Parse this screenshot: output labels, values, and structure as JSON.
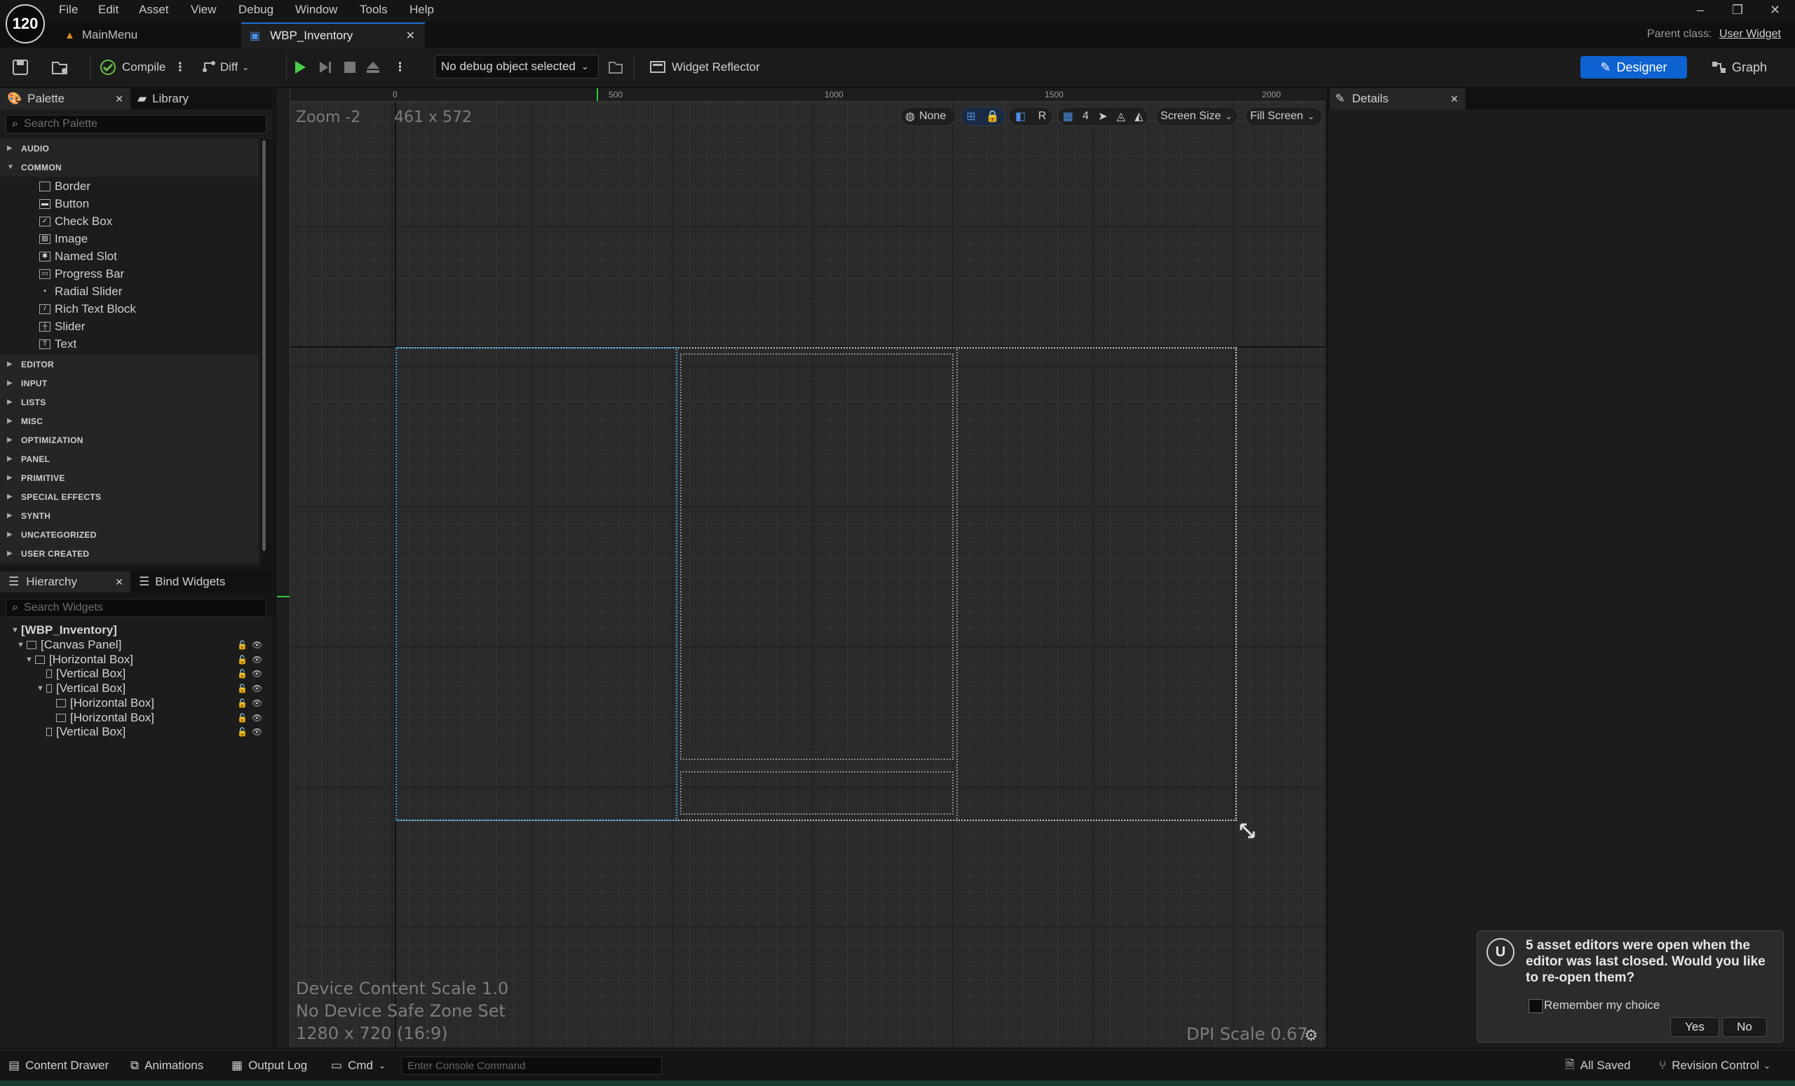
{
  "app": {
    "logo_text": "120"
  },
  "menu": [
    "File",
    "Edit",
    "Asset",
    "View",
    "Debug",
    "Window",
    "Tools",
    "Help"
  ],
  "window_controls": {
    "minimize": "–",
    "restore": "❐",
    "close": "✕"
  },
  "tabs": [
    {
      "label": "MainMenu",
      "active": false
    },
    {
      "label": "WBP_Inventory",
      "active": true
    }
  ],
  "parent_class": {
    "label": "Parent class:",
    "value": "User Widget"
  },
  "toolbar": {
    "compile_label": "Compile",
    "diff_label": "Diff",
    "debug_select": "No debug object selected",
    "widget_reflector": "Widget Reflector",
    "designer_label": "Designer",
    "graph_label": "Graph"
  },
  "palette": {
    "tab_label": "Palette",
    "library_label": "Library",
    "search_placeholder": "Search Palette",
    "categories_top": [
      "AUDIO",
      "COMMON"
    ],
    "common_items": [
      {
        "label": "Border",
        "icon": "border-icon"
      },
      {
        "label": "Button",
        "icon": "button-icon"
      },
      {
        "label": "Check Box",
        "icon": "checkbox-icon"
      },
      {
        "label": "Image",
        "icon": "image-icon"
      },
      {
        "label": "Named Slot",
        "icon": "named-slot-icon"
      },
      {
        "label": "Progress Bar",
        "icon": "progress-bar-icon"
      },
      {
        "label": "Radial Slider",
        "icon": "radial-slider-icon"
      },
      {
        "label": "Rich Text Block",
        "icon": "rich-text-icon"
      },
      {
        "label": "Slider",
        "icon": "slider-icon"
      },
      {
        "label": "Text",
        "icon": "text-icon"
      }
    ],
    "categories_bottom": [
      "EDITOR",
      "INPUT",
      "LISTS",
      "MISC",
      "OPTIMIZATION",
      "PANEL",
      "PRIMITIVE",
      "SPECIAL EFFECTS",
      "SYNTH",
      "UNCATEGORIZED",
      "USER CREATED"
    ]
  },
  "hierarchy": {
    "tab_label": "Hierarchy",
    "bind_label": "Bind Widgets",
    "search_placeholder": "Search Widgets",
    "root": "[WBP_Inventory]",
    "rows": [
      {
        "label": "[Canvas Panel]",
        "depth": 1,
        "expanded": true
      },
      {
        "label": "[Horizontal Box]",
        "depth": 2,
        "expanded": true
      },
      {
        "label": "[Vertical Box]",
        "depth": 3,
        "expanded": false
      },
      {
        "label": "[Vertical Box]",
        "depth": 3,
        "expanded": true
      },
      {
        "label": "[Horizontal Box]",
        "depth": 4,
        "expanded": false
      },
      {
        "label": "[Horizontal Box]",
        "depth": 4,
        "expanded": false
      },
      {
        "label": "[Vertical Box]",
        "depth": 3,
        "expanded": false
      }
    ]
  },
  "canvas": {
    "zoom": "Zoom -2",
    "size": "461 x 572",
    "ruler_top": [
      "0",
      "500",
      "1000",
      "1500",
      "2000"
    ],
    "tools": {
      "none_label": "None",
      "r_label": "R",
      "grid_size": "4",
      "screen_size": "Screen Size",
      "fill_screen": "Fill Screen"
    },
    "device_content_scale": "Device Content Scale 1.0",
    "safe_zone": "No Device Safe Zone Set",
    "resolution": "1280 x 720 (16:9)",
    "dpi_scale": "DPI Scale 0.67"
  },
  "details": {
    "tab_label": "Details"
  },
  "toast": {
    "message": "5 asset editors were open when the editor was last closed. Would you like to re-open them?",
    "remember": "Remember my choice",
    "yes": "Yes",
    "no": "No"
  },
  "statusbar": {
    "content_drawer": "Content Drawer",
    "animations": "Animations",
    "output_log": "Output Log",
    "cmd": "Cmd",
    "console_placeholder": "Enter Console Command",
    "all_saved": "All Saved",
    "revision_control": "Revision Control"
  },
  "colors": {
    "accent": "#0e62d1",
    "canvas_bg": "#2a2a2a",
    "selection": "#3aa0d8"
  }
}
